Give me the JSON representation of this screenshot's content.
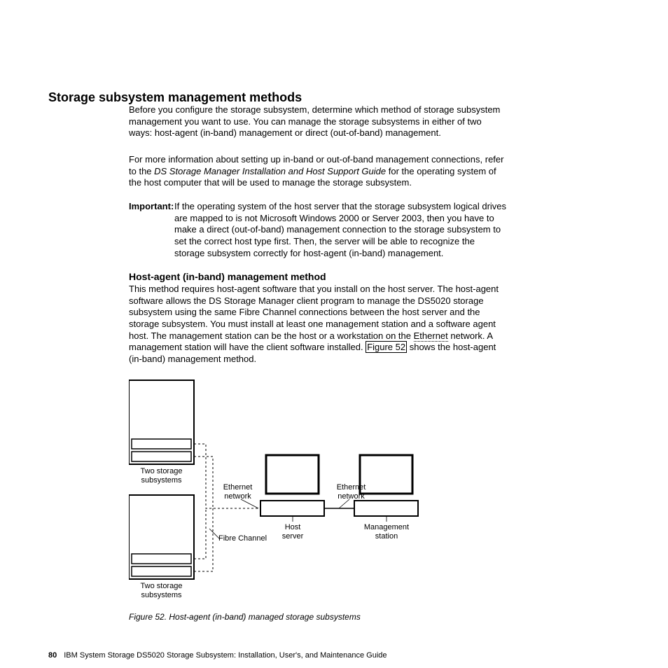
{
  "heading": "Storage subsystem management methods",
  "para1": "Before you configure the storage subsystem, determine which method of storage subsystem management you want to use. You can manage the storage subsystems in either of two ways: host-agent (in-band) management or direct (out-of-band) management.",
  "para2a": "For more information about setting up in-band or out-of-band management connections, refer to the ",
  "para2_italic": "DS Storage Manager Installation and Host Support Guide",
  "para2b": " for the operating system of the host computer that will be used to manage the storage subsystem.",
  "important_label": "Important:",
  "important_body": "If the operating system of the host server that the storage subsystem logical drives are mapped to is not Microsoft Windows 2000 or Server 2003, then you have to make a direct (out-of-band) management connection to the storage subsystem to set the correct host type first. Then, the server will be able to recognize the storage subsystem correctly for host-agent (in-band) management.",
  "subheading": "Host-agent (in-band) management method",
  "para3a": "This method requires host-agent software that you install on the host server. The host-agent software allows the DS Storage Manager client program to manage the DS5020 storage subsystem using the same Fibre Channel connections between the host server and the storage subsystem. You must install at least one management station and a software agent host. The management station can be the host or a workstation on the ",
  "para3_dotted": "Ethernet",
  "para3b": " network. A management station will have the client software installed. ",
  "para3_figref": "Figure 52",
  "para3c": " shows the host-agent (in-band) management method.",
  "figure_caption": "Figure 52. Host-agent (in-band) managed storage subsystems",
  "footer_pageno": "80",
  "footer_text": "IBM System Storage DS5020 Storage Subsystem:  Installation, User's, and Maintenance Guide",
  "diagram": {
    "label_storage_top": "Two storage\nsubsystems",
    "label_storage_bottom": "Two storage\nsubsystems",
    "label_ethernet_left": "Ethernet\nnetwork",
    "label_ethernet_right": "Ethernet\nnetwork",
    "label_fibre": "Fibre Channel",
    "label_host": "Host\nserver",
    "label_mgmt": "Management\nstation"
  }
}
